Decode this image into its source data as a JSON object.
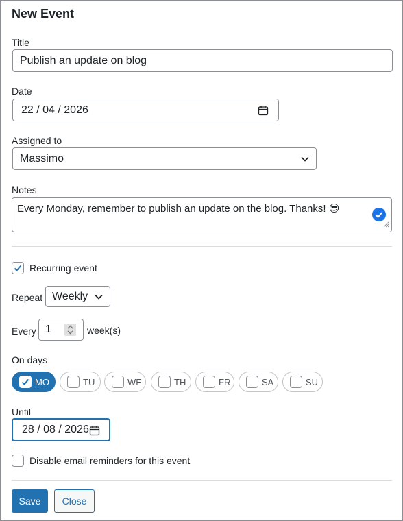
{
  "dialog": {
    "title": "New Event"
  },
  "form": {
    "title_label": "Title",
    "title_value": "Publish an update on blog",
    "date_label": "Date",
    "date_value": "22 / 04 / 2026",
    "assigned_label": "Assigned to",
    "assigned_value": "Massimo",
    "notes_label": "Notes",
    "notes_value": "Every Monday, remember to publish an update on the blog. Thanks! 😎"
  },
  "recurrence": {
    "recurring_label": "Recurring event",
    "recurring_checked": true,
    "repeat_label": "Repeat",
    "repeat_value": "Weekly",
    "every_label": "Every",
    "every_value": "1",
    "every_unit": "week(s)",
    "on_days_label": "On days",
    "days": [
      {
        "label": "MO",
        "checked": true
      },
      {
        "label": "TU",
        "checked": false
      },
      {
        "label": "WE",
        "checked": false
      },
      {
        "label": "TH",
        "checked": false
      },
      {
        "label": "FR",
        "checked": false
      },
      {
        "label": "SA",
        "checked": false
      },
      {
        "label": "SU",
        "checked": false
      }
    ],
    "until_label": "Until",
    "until_value": "28 / 08 / 2026"
  },
  "reminders": {
    "disable_label": "Disable email reminders for this event",
    "disable_checked": false
  },
  "buttons": {
    "save": "Save",
    "close": "Close"
  },
  "colors": {
    "accent": "#2271b1",
    "border": "#8c8f94",
    "text": "#1d2327"
  }
}
